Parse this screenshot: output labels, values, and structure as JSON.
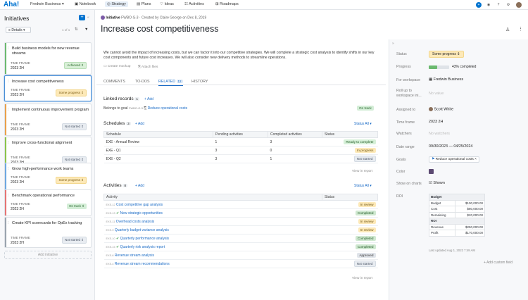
{
  "nav": {
    "logo": "Aha!",
    "workspace": "Fredwin Business",
    "items": [
      {
        "label": "Notebook"
      },
      {
        "label": "Strategy"
      },
      {
        "label": "Plans"
      },
      {
        "label": "Ideas"
      },
      {
        "label": "Activities"
      },
      {
        "label": "Roadmaps"
      }
    ]
  },
  "left": {
    "title": "Initiatives",
    "filter_label": "Details",
    "pager": "1 of 1",
    "cards": [
      {
        "title": "Build business models for new revenue streams",
        "timeframe_label": "TIME FRAME",
        "year": "2023 2H",
        "status": "Achieved",
        "accent": "#6bb96f"
      },
      {
        "title": "Increase cost competitiveness",
        "timeframe_label": "TIME FRAME",
        "year": "2023 2H",
        "status": "Some progress",
        "accent": "#4b8fd6"
      },
      {
        "title": "Implement continuous improvement program",
        "timeframe_label": "TIME FRAME",
        "year": "2023 2H",
        "status": "Not started",
        "accent": "#e9a04a"
      },
      {
        "title": "Improve cross-functional alignment",
        "timeframe_label": "TIME FRAME",
        "year": "2023 2H",
        "status": "Not started",
        "accent": "#8bc34a"
      },
      {
        "title": "Grow high-performance work teams",
        "timeframe_label": "TIME FRAME",
        "year": "2023 2H",
        "status": "Some progress",
        "accent": "#6da7e0"
      },
      {
        "title": "Benchmark operational performance",
        "timeframe_label": "TIME FRAME",
        "year": "2023 2H",
        "status": "On track",
        "accent": "#e57373"
      },
      {
        "title": "Create KPI scorecards for OpEx tracking",
        "timeframe_label": "TIME FRAME",
        "year": "2023 2H",
        "status": "Not started",
        "accent": "#9aa4ae"
      }
    ],
    "add_label": "Add initiative"
  },
  "header": {
    "type_label": "Initiative",
    "ref": "FWBO-S-3",
    "created": "Created by Claire George on Dec 8, 2019",
    "title": "Increase cost competitiveness"
  },
  "description": "We cannot avoid the impact of increasing costs, but we can factor it into our competitive strategies. We will complete a strategic cost analysis to identify shifts in our key cost components and future cost increases. We will also consider new delivery methods to streamline operations.",
  "desc_actions": {
    "mockup": "Create mockup",
    "attach": "Attach files"
  },
  "tabs": {
    "comments": "COMMENTS",
    "todos": "TO-DOS",
    "related": "RELATED",
    "related_count": "12",
    "history": "HISTORY"
  },
  "linked": {
    "title": "Linked records",
    "count": "1",
    "add": "+ Add",
    "belongs": "Belongs to goal",
    "goal_ref": "FWBO-G-3",
    "goal_name": "Reduce operational costs",
    "goal_status": "On track"
  },
  "schedules": {
    "title": "Schedules",
    "count": "3",
    "add": "+ Add",
    "filter": "Status All",
    "columns": [
      "Schedule",
      "Pending activities",
      "Completed activities",
      "Status"
    ],
    "rows": [
      {
        "name": "EXE - Annual Review",
        "pending": "1",
        "completed": "3",
        "status": "Ready to complete"
      },
      {
        "name": "EXE - Q1",
        "pending": "3",
        "completed": "0",
        "status": "In progress"
      },
      {
        "name": "EXE - Q2",
        "pending": "3",
        "completed": "1",
        "status": "Not started"
      }
    ],
    "view": "View in report"
  },
  "activities": {
    "title": "Activities",
    "count": "8",
    "add": "+ Add",
    "filter": "Status All",
    "columns": [
      "Activity",
      "Status"
    ],
    "rows": [
      {
        "ref": "EXE-12",
        "name": "Cost competitive gap analysis",
        "status": "In review",
        "done": false
      },
      {
        "ref": "EXE-13",
        "name": "New strategic opportunities",
        "status": "Completed",
        "done": true
      },
      {
        "ref": "EXE-11",
        "name": "Overhead costs analysis",
        "status": "In review",
        "done": false
      },
      {
        "ref": "EXE-9",
        "name": "Quarterly budget variance analysis",
        "status": "In review",
        "done": false
      },
      {
        "ref": "EXE-10",
        "name": "Quarterly performance analysis",
        "status": "Completed",
        "done": true
      },
      {
        "ref": "EXE-15",
        "name": "Quarterly risk analysis report",
        "status": "Completed",
        "done": true
      },
      {
        "ref": "EXE-6",
        "name": "Revenue stream analysis",
        "status": "Approved",
        "done": false
      },
      {
        "ref": "EXE-4",
        "name": "Revenue stream recommendations",
        "status": "Not started",
        "done": false
      }
    ],
    "view": "View in report"
  },
  "right": {
    "status_label": "Status",
    "status_value": "Some progress",
    "progress_label": "Progress",
    "progress_value": "43% completed",
    "progress_fraction": 0.43,
    "workspace_label": "For workspace",
    "workspace_value": "Fredwin Business",
    "rollup_label": "Roll up to workspace ini...",
    "rollup_value": "No value",
    "assigned_label": "Assigned to",
    "assigned_value": "Scott White",
    "timeframe_label": "Time frame",
    "timeframe_value": "2023 2H",
    "watchers_label": "Watchers",
    "watchers_value": "No watchers",
    "date_label": "Date range",
    "date_start": "09/30/2023",
    "date_end": "04/25/2024",
    "goals_label": "Goals",
    "goals_value": "Reduce operational costs",
    "color_label": "Color",
    "color_value": "#5c4a72",
    "charts_label": "Show on charts",
    "charts_value": "Shown",
    "roi_label": "ROI",
    "roi": {
      "budget_header": "Budget",
      "budget_rows": [
        [
          "Budget",
          "$100,000.00"
        ],
        [
          "Cost",
          "$80,000.00"
        ],
        [
          "Remaining",
          "$20,000.00"
        ]
      ],
      "roi_header": "ROI",
      "roi_rows": [
        [
          "Revenue",
          "$250,000.00"
        ],
        [
          "Profit",
          "$170,000.00"
        ]
      ],
      "updated": "Last updated Aug 1, 2022 7:49 AM"
    },
    "add_custom": "+ Add custom field"
  }
}
